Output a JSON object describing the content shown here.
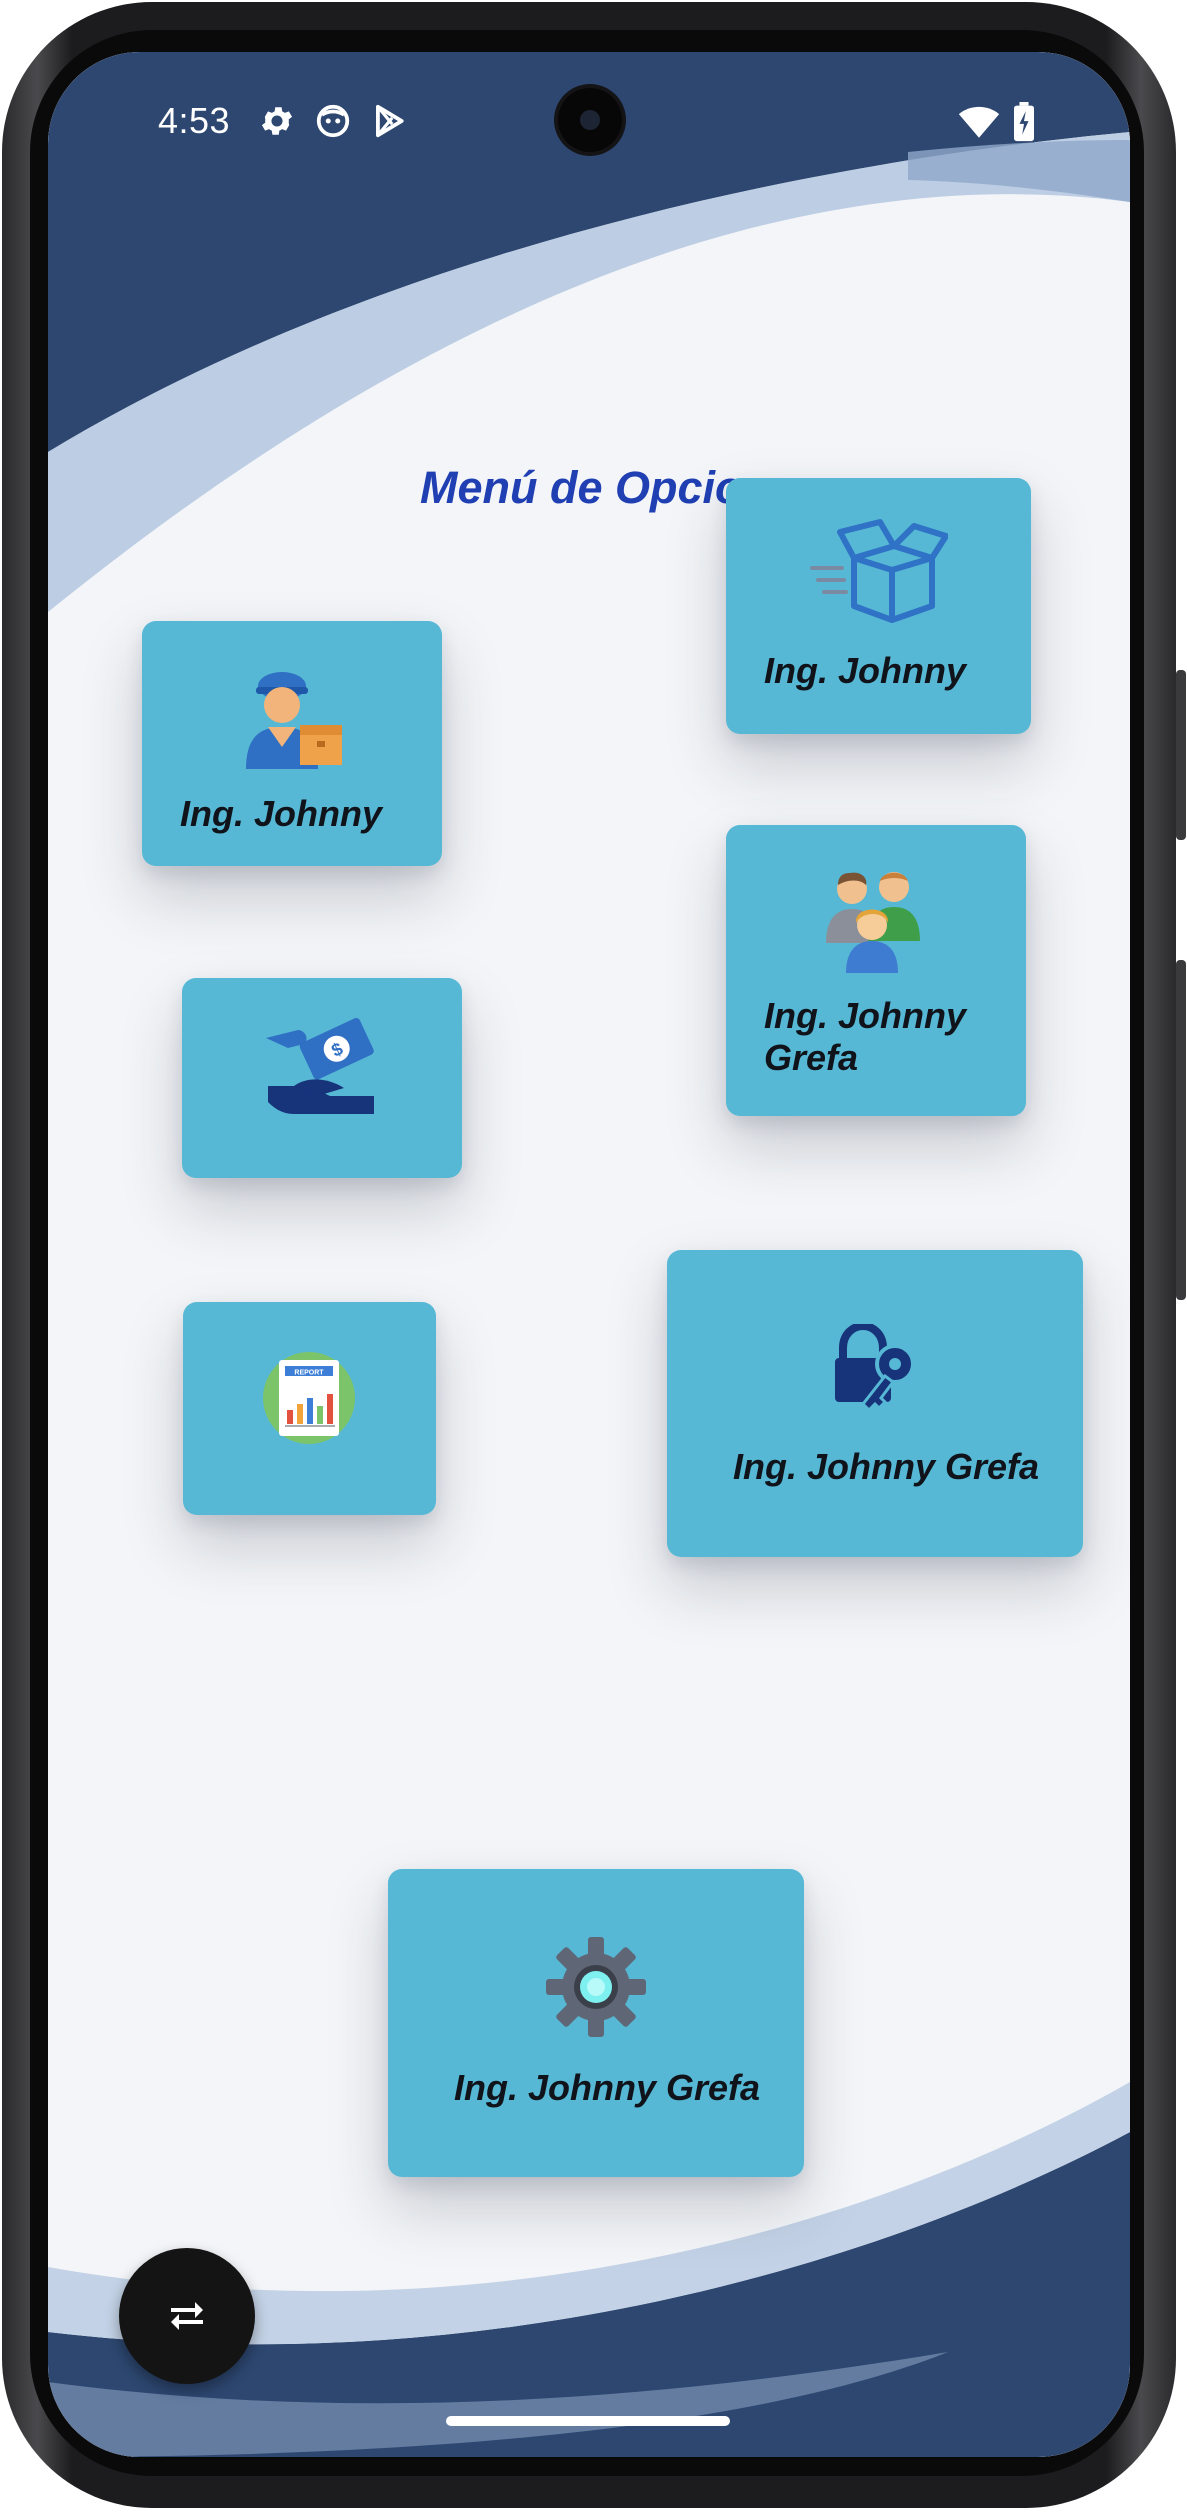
{
  "status_bar": {
    "time": "4:53",
    "icons": [
      "gear-icon",
      "android-icon",
      "play-store-icon",
      "wifi-icon",
      "battery-charging-icon"
    ]
  },
  "page": {
    "title": "Menú de Opcio"
  },
  "cards": [
    {
      "id": "products",
      "icon": "open-box-icon",
      "label": "Ing. Johnny"
    },
    {
      "id": "employees",
      "icon": "delivery-worker-icon",
      "label": "Ing. Johnny"
    },
    {
      "id": "clients",
      "icon": "people-group-icon",
      "label": "Ing. Johnny Grefa"
    },
    {
      "id": "payments",
      "icon": "money-hand-icon",
      "label": ""
    },
    {
      "id": "reports",
      "icon": "report-chart-icon",
      "label": ""
    },
    {
      "id": "security",
      "icon": "lock-key-icon",
      "label": "Ing. Johnny Grefa"
    },
    {
      "id": "settings",
      "icon": "gear-icon",
      "label": "Ing. Johnny Grefa"
    }
  ],
  "fab": {
    "icon": "rotate-icon"
  },
  "colors": {
    "navy": "#2d4770",
    "card": "#56b8d5",
    "title": "#1f3fb3",
    "swoosh": "#b6c9e2"
  }
}
